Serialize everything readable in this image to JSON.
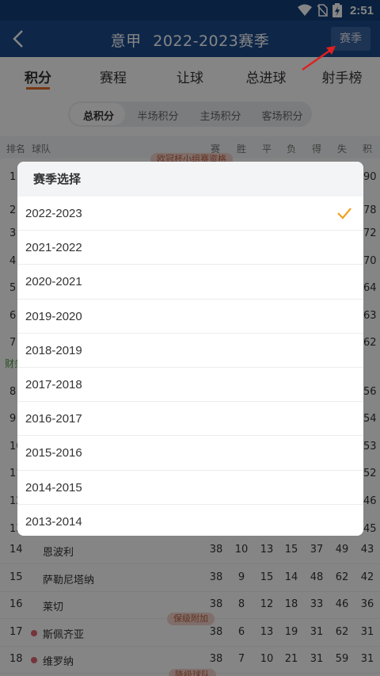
{
  "status": {
    "time": "2:51"
  },
  "nav": {
    "title_league": "意甲",
    "title_season": "2022-2023赛季",
    "season_button": "赛季"
  },
  "tabs": [
    {
      "label": "积分"
    },
    {
      "label": "赛程"
    },
    {
      "label": "让球"
    },
    {
      "label": "总进球"
    },
    {
      "label": "射手榜"
    }
  ],
  "subtabs": [
    {
      "label": "总积分"
    },
    {
      "label": "半场积分"
    },
    {
      "label": "主场积分"
    },
    {
      "label": "客场积分"
    }
  ],
  "table": {
    "headers": [
      "排名",
      "球队",
      "赛",
      "胜",
      "平",
      "负",
      "得",
      "失",
      "积"
    ],
    "top_tag": "欧冠杯小组赛资格",
    "side_note": "财务",
    "partial_ranks": [
      "1",
      "2",
      "3",
      "4",
      "5",
      "6",
      "7",
      "8",
      "9",
      "10",
      "11",
      "12",
      "13"
    ],
    "partial_points": [
      "90",
      "78",
      "72",
      "70",
      "64",
      "63",
      "62",
      "56",
      "54",
      "53",
      "52",
      "46",
      "45"
    ],
    "rows": [
      {
        "rank": "14",
        "team": "恩波利",
        "p": "38",
        "w": "10",
        "d": "13",
        "l": "15",
        "gf": "37",
        "ga": "49",
        "pts": "43",
        "dot": false
      },
      {
        "rank": "15",
        "team": "萨勒尼塔纳",
        "p": "38",
        "w": "9",
        "d": "15",
        "l": "14",
        "gf": "48",
        "ga": "62",
        "pts": "42",
        "dot": false
      },
      {
        "rank": "16",
        "team": "莱切",
        "p": "38",
        "w": "8",
        "d": "12",
        "l": "18",
        "gf": "33",
        "ga": "46",
        "pts": "36",
        "dot": false
      },
      {
        "rank": "17",
        "team": "斯佩齐亚",
        "p": "38",
        "w": "6",
        "d": "13",
        "l": "19",
        "gf": "31",
        "ga": "62",
        "pts": "31",
        "dot": true
      },
      {
        "rank": "18",
        "team": "维罗纳",
        "p": "38",
        "w": "7",
        "d": "10",
        "l": "21",
        "gf": "31",
        "ga": "59",
        "pts": "31",
        "dot": true
      }
    ],
    "tag_playoff": "保级附加",
    "tag_relegation": "降级球队"
  },
  "dialog": {
    "title": "赛季选择",
    "options": [
      "2022-2023",
      "2021-2022",
      "2020-2021",
      "2019-2020",
      "2018-2019",
      "2017-2018",
      "2016-2017",
      "2015-2016",
      "2014-2015",
      "2013-2014"
    ],
    "selected": "2022-2023"
  },
  "colors": {
    "nav": "#1c4b8c",
    "accent": "#e06a2a",
    "check": "#f0a020",
    "arrow": "#e02020"
  }
}
